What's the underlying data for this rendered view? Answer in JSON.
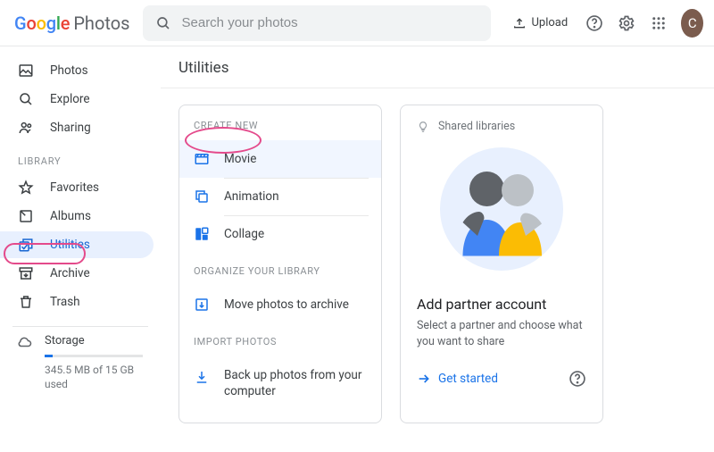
{
  "header": {
    "logo_product": "Photos",
    "search_placeholder": "Search your photos",
    "upload_label": "Upload",
    "avatar_letter": "C"
  },
  "sidebar": {
    "items": [
      {
        "label": "Photos"
      },
      {
        "label": "Explore"
      },
      {
        "label": "Sharing"
      }
    ],
    "section_label": "LIBRARY",
    "library": [
      {
        "label": "Favorites"
      },
      {
        "label": "Albums"
      },
      {
        "label": "Utilities"
      },
      {
        "label": "Archive"
      },
      {
        "label": "Trash"
      }
    ],
    "storage": {
      "title": "Storage",
      "detail": "345.5 MB of 15 GB used"
    }
  },
  "main": {
    "title": "Utilities",
    "create_label": "CREATE NEW",
    "create": [
      {
        "label": "Movie"
      },
      {
        "label": "Animation"
      },
      {
        "label": "Collage"
      }
    ],
    "organize_label": "ORGANIZE YOUR LIBRARY",
    "organize": [
      {
        "label": "Move photos to archive"
      }
    ],
    "import_label": "IMPORT PHOTOS",
    "import": [
      {
        "label": "Back up photos from your computer"
      }
    ],
    "partner": {
      "hint": "Shared libraries",
      "title": "Add partner account",
      "subtitle": "Select a partner and choose what you want to share",
      "cta": "Get started"
    }
  }
}
